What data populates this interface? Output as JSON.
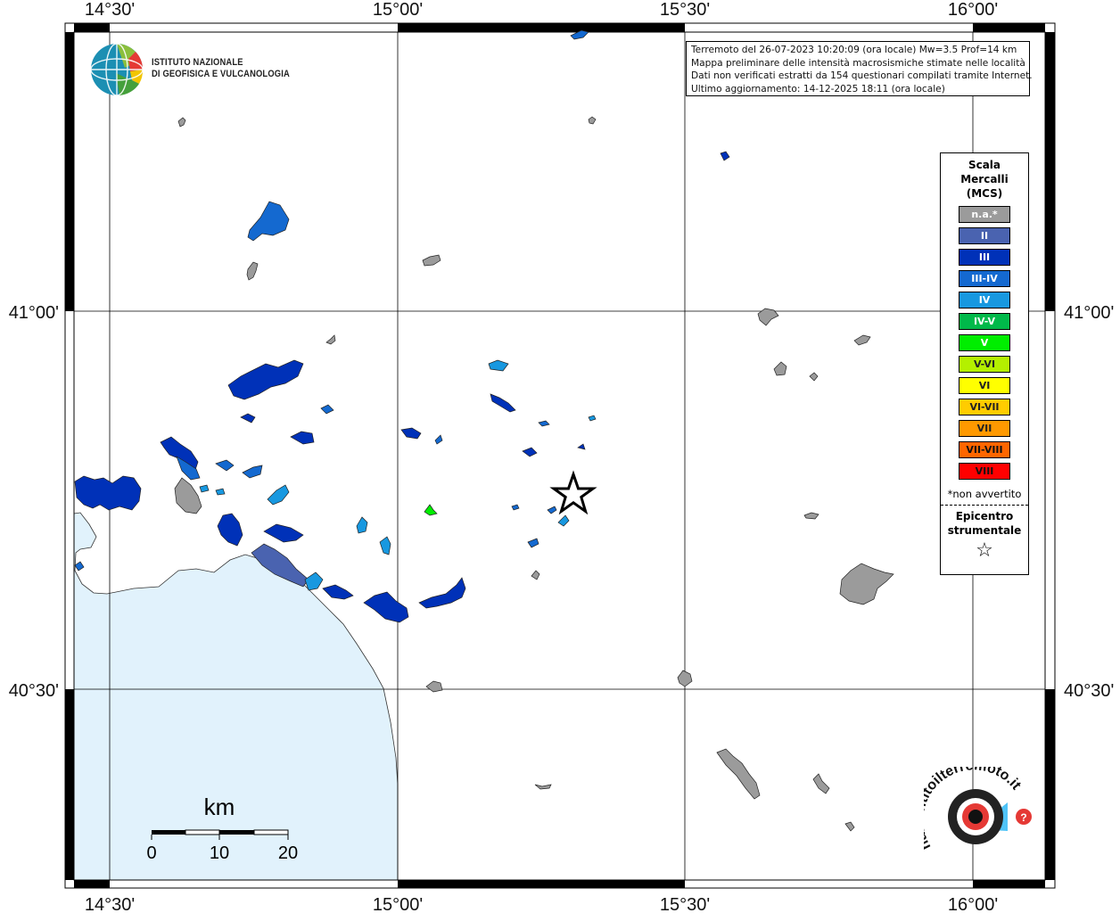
{
  "map": {
    "colors": {
      "sea": "#e1f2fc",
      "land": "#ffffff",
      "frame": "#000000",
      "place_na": "#9b9b9b",
      "place_II": "#4a63b0",
      "place_III": "#0031b8",
      "place_III_IV": "#1469d0",
      "place_IV": "#1898e0",
      "place_V": "#00ee00"
    },
    "graticule": {
      "top_labels": [
        "14°30'",
        "15°00'",
        "15°30'",
        "16°00'"
      ],
      "bottom_labels": [
        "14°30'",
        "15°00'",
        "15°30'",
        "16°00'"
      ],
      "left_labels": [
        "41°00'",
        "40°30'"
      ],
      "right_labels": [
        "41°00'",
        "40°30'"
      ]
    },
    "info_lines": [
      "Terremoto del 26-07-2023 10:20:09 (ora locale) Mw=3.5 Prof=14 km",
      "Mappa preliminare delle intensità macrosismiche stimate nelle località",
      "Dati non verificati estratti da 154 questionari compilati tramite Internet.",
      "Ultimo aggiornamento: 14-12-2025 18:11 (ora locale)"
    ],
    "logo": {
      "line1": "ISTITUTO NAZIONALE",
      "line2": "DI GEOFISICA E VULCANOLOGIA",
      "icon": "ingv-globe-icon"
    },
    "scale_bar": {
      "unit": "km",
      "ticks": [
        "0",
        "10",
        "20"
      ]
    },
    "epicenter_icon": "star-icon",
    "watermark": {
      "text": "haisentitoilterremoto.it  www.",
      "icon": "hai-sentito-logo-icon"
    }
  },
  "legend": {
    "title_1": "Scala",
    "title_2": "Mercalli",
    "title_3": "(MCS)",
    "items": [
      {
        "label": "n.a.*",
        "color": "#9b9b9b"
      },
      {
        "label": "II",
        "color": "#4a63b0"
      },
      {
        "label": "III",
        "color": "#0031b8"
      },
      {
        "label": "III-IV",
        "color": "#1469d0"
      },
      {
        "label": "IV",
        "color": "#1898e0"
      },
      {
        "label": "IV-V",
        "color": "#00b94a"
      },
      {
        "label": "V",
        "color": "#00ee00"
      },
      {
        "label": "V-VI",
        "color": "#b4f000"
      },
      {
        "label": "VI",
        "color": "#ffff00"
      },
      {
        "label": "VI-VII",
        "color": "#ffcc00"
      },
      {
        "label": "VII",
        "color": "#ff9900"
      },
      {
        "label": "VII-VIII",
        "color": "#ff6600"
      },
      {
        "label": "VIII",
        "color": "#ff0000"
      }
    ],
    "note": "*non avvertito",
    "epicenter_1": "Epicentro",
    "epicenter_2": "strumentale",
    "epicenter_symbol": "☆"
  }
}
